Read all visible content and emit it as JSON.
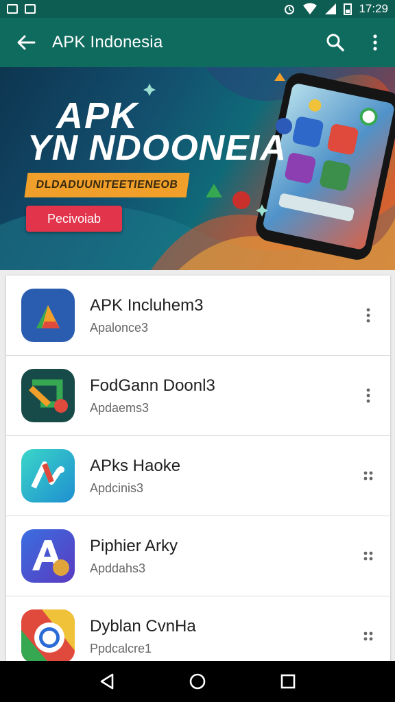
{
  "status_bar": {
    "time": "17:29"
  },
  "app_bar": {
    "title": "APK Indonesia",
    "icons": [
      "back-arrow-icon",
      "search-icon",
      "more-vert-icon"
    ]
  },
  "banner": {
    "title_line1": "APK",
    "title_line2": "YN NDOONEIA",
    "ribbon_text": "DLDADUUNITEETIENEOB",
    "button_label": "Pecivoiab"
  },
  "apps": [
    {
      "name": "APK Incluhem3",
      "subtitle": "Apalonce3",
      "icon": "drive-triangle-icon"
    },
    {
      "name": "FodGann Doonl3",
      "subtitle": "Apdaems3",
      "icon": "green-arrow-icon"
    },
    {
      "name": "APks Haoke",
      "subtitle": "Apdcinis3",
      "icon": "teal-a-icon"
    },
    {
      "name": "Piphier Arky",
      "subtitle": "Apddahs3",
      "icon": "blue-a-icon"
    },
    {
      "name": "Dyblan CvnHa",
      "subtitle": "Ppdcalcre1",
      "icon": "chrome-ring-icon"
    }
  ],
  "colors": {
    "status_bar": "#0e5d52",
    "app_bar": "#0f6b5e",
    "ribbon": "#f0a02a",
    "banner_button": "#e2344a"
  }
}
